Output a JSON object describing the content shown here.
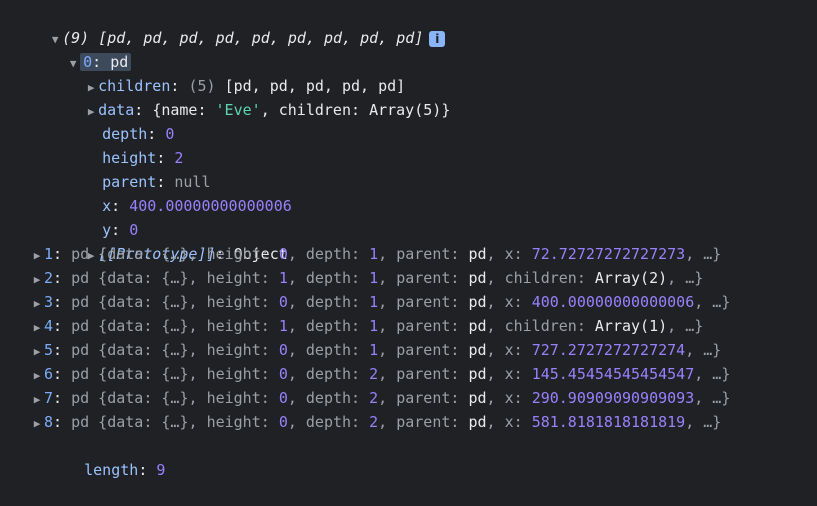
{
  "summary": {
    "count": "(9)",
    "preview": "[pd, pd, pd, pd, pd, pd, pd, pd, pd]",
    "info_icon": "i"
  },
  "item0": {
    "index": "0",
    "label": "pd",
    "children": {
      "key": "children",
      "count": "(5)",
      "preview": "[pd, pd, pd, pd, pd]"
    },
    "data": {
      "key": "data",
      "open": "{name: ",
      "name_val": "'Eve'",
      "mid": ", children: ",
      "arr": "Array(5)",
      "close": "}"
    },
    "depth": {
      "key": "depth",
      "val": "0"
    },
    "height": {
      "key": "height",
      "val": "2"
    },
    "parent": {
      "key": "parent",
      "val": "null"
    },
    "x": {
      "key": "x",
      "val": "400.00000000000006"
    },
    "y": {
      "key": "y",
      "val": "0"
    },
    "proto": {
      "key": "[[Prototype]]",
      "val": "Object"
    }
  },
  "items": [
    {
      "idx": "1",
      "height": "0",
      "depth": "1",
      "tailkey": "x",
      "tailval": "72.72727272727273"
    },
    {
      "idx": "2",
      "height": "1",
      "depth": "1",
      "tailkey": "children",
      "tailval": "Array(2)"
    },
    {
      "idx": "3",
      "height": "0",
      "depth": "1",
      "tailkey": "x",
      "tailval": "400.00000000000006"
    },
    {
      "idx": "4",
      "height": "1",
      "depth": "1",
      "tailkey": "children",
      "tailval": "Array(1)"
    },
    {
      "idx": "5",
      "height": "0",
      "depth": "1",
      "tailkey": "x",
      "tailval": "727.2727272727274"
    },
    {
      "idx": "6",
      "height": "0",
      "depth": "2",
      "tailkey": "x",
      "tailval": "145.45454545454547"
    },
    {
      "idx": "7",
      "height": "0",
      "depth": "2",
      "tailkey": "x",
      "tailval": "290.90909090909093"
    },
    {
      "idx": "8",
      "height": "0",
      "depth": "2",
      "tailkey": "x",
      "tailval": "581.8181818181819"
    }
  ],
  "length": {
    "key": "length",
    "val": "9"
  },
  "colors": {
    "background": "#202124",
    "key": "#9ac2ff",
    "string": "#5cd5b0",
    "number": "#9980ff",
    "info_badge": "#8ab4f8"
  }
}
